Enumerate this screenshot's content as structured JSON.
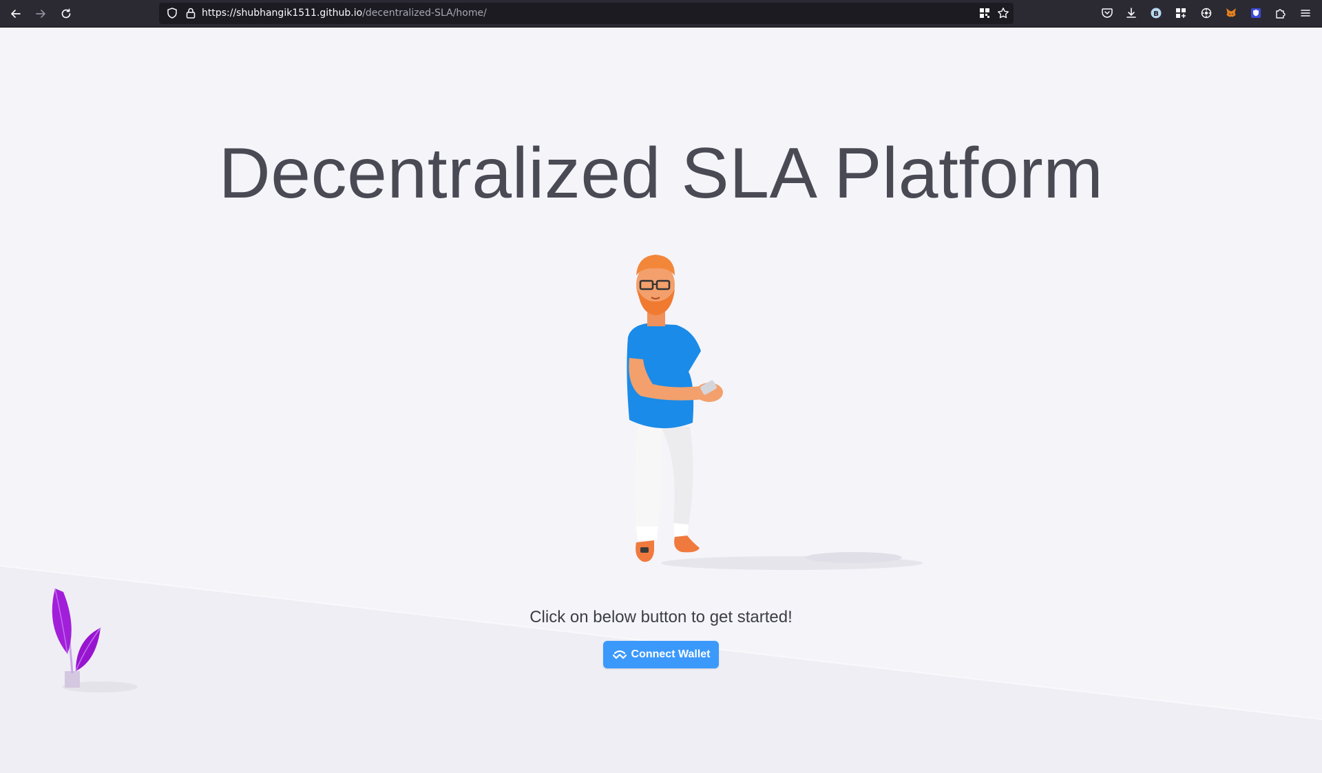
{
  "browser": {
    "url_host": "https://shubhangik1511.github.io",
    "url_path": "/decentralized-SLA/home/",
    "icons": {
      "back": "arrow-left-icon",
      "forward": "arrow-right-icon",
      "reload": "reload-icon",
      "shield": "shield-icon",
      "lock": "lock-icon",
      "qr": "qr-code-icon",
      "bookmark": "star-icon",
      "pocket": "pocket-icon",
      "download": "download-icon",
      "extensions": [
        "b-extension-icon",
        "grid-extension-icon",
        "puzzle-gear-icon",
        "metamask-fox-icon",
        "shield-extension-icon",
        "puzzle-icon"
      ],
      "menu": "hamburger-menu-icon"
    }
  },
  "page": {
    "headline": "Decentralized SLA Platform",
    "tagline": "Click on below button to get started!",
    "connect_button_label": "Connect Wallet",
    "illustration": "man-holding-phone-illustration",
    "plant": "purple-plant-illustration"
  },
  "colors": {
    "background": "#f4f4f9",
    "headline": "#4a4a55",
    "button": "#3b99fc",
    "browser_chrome": "#2b2a33",
    "plant": "#a21fd9",
    "shirt": "#1a8be8",
    "hair": "#f2873a"
  }
}
